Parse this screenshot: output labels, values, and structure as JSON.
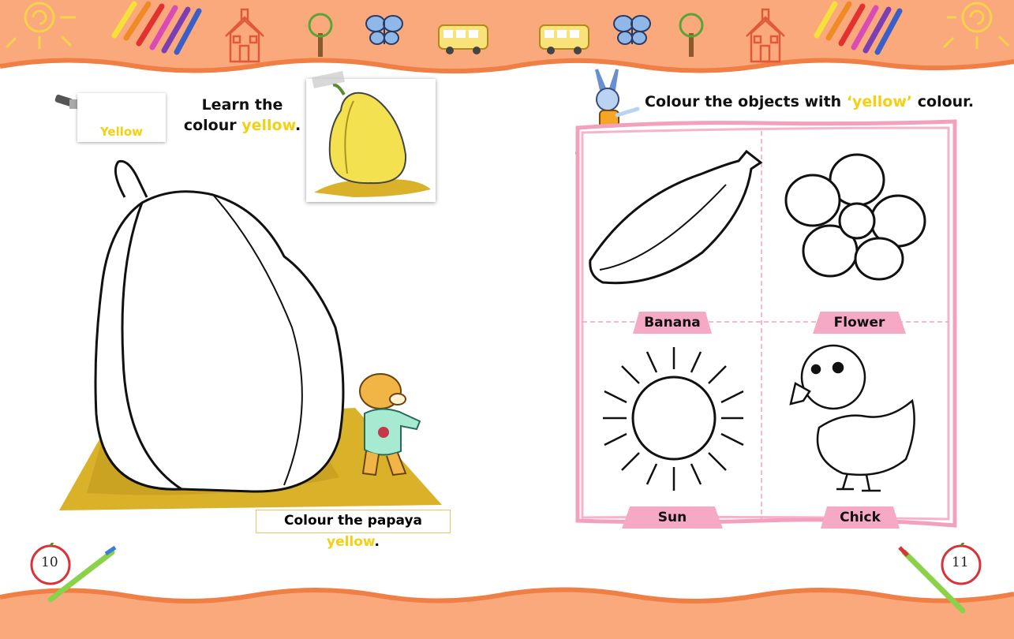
{
  "left_page": {
    "swatch_label": "Yellow",
    "heading_line1": "Learn the",
    "heading_line2_pre": "colour ",
    "heading_line2_colored": "yellow",
    "heading_line2_post": ".",
    "caption_pre": "Colour the papaya ",
    "caption_colored": "yellow",
    "caption_post": ".",
    "page_number": "10"
  },
  "right_page": {
    "instruction_pre": "Colour the objects with ",
    "instruction_colored": "‘yellow’",
    "instruction_post": " colour.",
    "objects": [
      "Banana",
      "Flower",
      "Sun",
      "Chick"
    ],
    "page_number": "11"
  },
  "colors": {
    "band": "#f9a97c",
    "band_edge": "#f07f45",
    "highlight_yellow": "#f5cf12",
    "label_pink": "#f6a9c4",
    "frame_pink": "#f3a0bf",
    "ground_mustard": "#d9b229"
  }
}
